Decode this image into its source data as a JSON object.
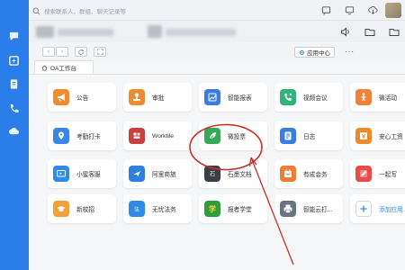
{
  "search": {
    "placeholder": "搜索联系人、群组、聊天记录等"
  },
  "nav": {
    "app_center": "应用中心",
    "more": "···"
  },
  "workspace_tab": {
    "label": "OA工作台"
  },
  "apps": [
    {
      "label": "公告",
      "color": "#f28a2e",
      "icon": "megaphone-icon"
    },
    {
      "label": "审批",
      "color": "#ee8a30",
      "icon": "stamp-icon"
    },
    {
      "label": "智能报表",
      "color": "#3a7de0",
      "icon": "chart-icon"
    },
    {
      "label": "视频会议",
      "color": "#2fb57c",
      "icon": "video-call-icon"
    },
    {
      "label": "微活动",
      "color": "#f0823a",
      "icon": "activity-icon"
    },
    {
      "label": "考勤打卡",
      "color": "#3a86e8",
      "icon": "location-icon"
    },
    {
      "label": "Worktile",
      "color": "#c94040",
      "icon": "worktile-icon"
    },
    {
      "label": "微投票",
      "color": "#35a957",
      "icon": "leaf-vote-icon"
    },
    {
      "label": "日志",
      "color": "#3a7de0",
      "icon": "log-icon"
    },
    {
      "label": "安心工资",
      "color": "#ef8a2c",
      "icon": "salary-icon"
    },
    {
      "label": "小蜜客服",
      "color": "#2e8be6",
      "icon": "service-icon"
    },
    {
      "label": "阿里商旅",
      "color": "#2d7fe0",
      "icon": "travel-icon"
    },
    {
      "label": "石墨文档",
      "color": "#3a3f45",
      "icon": "shimo-icon"
    },
    {
      "label": "有成会务",
      "color": "#f07c35",
      "icon": "event-icon"
    },
    {
      "label": "一起写",
      "color": "#e94a4a",
      "icon": "cowrite-icon"
    },
    {
      "label": "新校招",
      "color": "#f2a13a",
      "icon": "campus-icon"
    },
    {
      "label": "无忧法务",
      "color": "#2e8be6",
      "icon": "legal-icon"
    },
    {
      "label": "报者学堂",
      "color": "#2f9e3d",
      "icon": "school-icon"
    },
    {
      "label": "智能云打...",
      "color": "#6b7280",
      "icon": "printer-icon"
    },
    {
      "label": "添加应用...",
      "color": "#3a86e8",
      "icon": "add-icon"
    }
  ]
}
